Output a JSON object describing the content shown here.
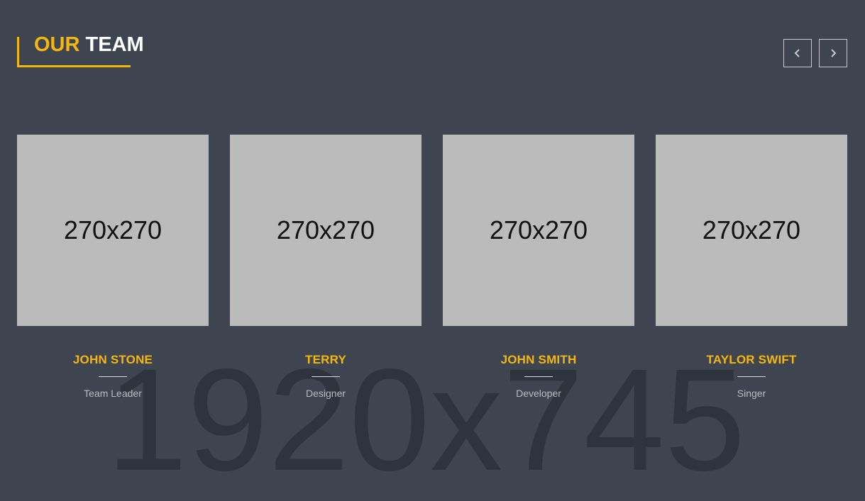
{
  "background_watermark": "1920x745",
  "section": {
    "title_accent": "OUR",
    "title_main": "TEAM"
  },
  "navigation": {
    "prev_icon": "chevron-left-icon",
    "next_icon": "chevron-right-icon"
  },
  "colors": {
    "accent": "#f5b70e",
    "background": "#3e4550",
    "placeholder": "#bbbbbb"
  },
  "team": [
    {
      "photo_label": "270x270",
      "name": "JOHN STONE",
      "role": "Team Leader"
    },
    {
      "photo_label": "270x270",
      "name": "TERRY",
      "role": "Designer"
    },
    {
      "photo_label": "270x270",
      "name": "JOHN SMITH",
      "role": "Developer"
    },
    {
      "photo_label": "270x270",
      "name": "TAYLOR SWIFT",
      "role": "Singer"
    }
  ]
}
